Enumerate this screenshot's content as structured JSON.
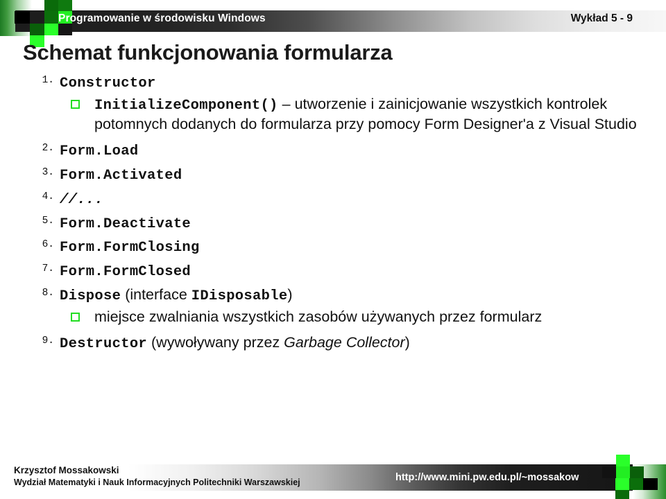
{
  "header": {
    "course_title": "Programowanie w środowisku Windows",
    "lecture_label": "Wykład 5 - 9",
    "decoration_icon": "checkered-squares-icon"
  },
  "title": "Schemat funkcjonowania formularza",
  "colors": {
    "accent_green": "#22dd22",
    "dark_green": "#0a6b0a",
    "bright_green": "#22ee22",
    "bar_dark": "#1c1c1c",
    "text": "#111111"
  },
  "list": [
    {
      "number": "1.",
      "code": "Constructor",
      "sub": [
        {
          "bullet": "square-bullet-icon",
          "code": "InitializeComponent()",
          "dash": "–",
          "text": "utworzenie i zainicjowanie wszystkich kontrolek potomnych dodanych do formularza przy pomocy Form Designer'a z Visual Studio"
        }
      ]
    },
    {
      "number": "2.",
      "code": "Form.Load",
      "sub": []
    },
    {
      "number": "3.",
      "code": "Form.Activated",
      "sub": []
    },
    {
      "number": "4.",
      "code": "//...",
      "italic": true,
      "sub": []
    },
    {
      "number": "5.",
      "code": "Form.Deactivate",
      "sub": []
    },
    {
      "number": "6.",
      "code": "Form.FormClosing",
      "sub": []
    },
    {
      "number": "7.",
      "code": "Form.FormClosed",
      "sub": []
    },
    {
      "number": "8.",
      "code": "Dispose",
      "paren_open": " (interface ",
      "code2": "IDisposable",
      "paren_close": ")",
      "sub": [
        {
          "bullet": "square-bullet-icon",
          "text": "miejsce zwalniania wszystkich zasobów używanych przez formularz"
        }
      ]
    },
    {
      "number": "9.",
      "code": "Destructor",
      "paren_open": " (wywoływany przez ",
      "italic_text": "Garbage Collector",
      "paren_close": ")",
      "sub": []
    }
  ],
  "footer": {
    "author": "Krzysztof Mossakowski",
    "department": "Wydział Matematyki i Nauk Informacyjnych Politechniki Warszawskiej",
    "url": "http://www.mini.pw.edu.pl/~mossakow",
    "decoration_icon": "checkered-squares-icon"
  }
}
